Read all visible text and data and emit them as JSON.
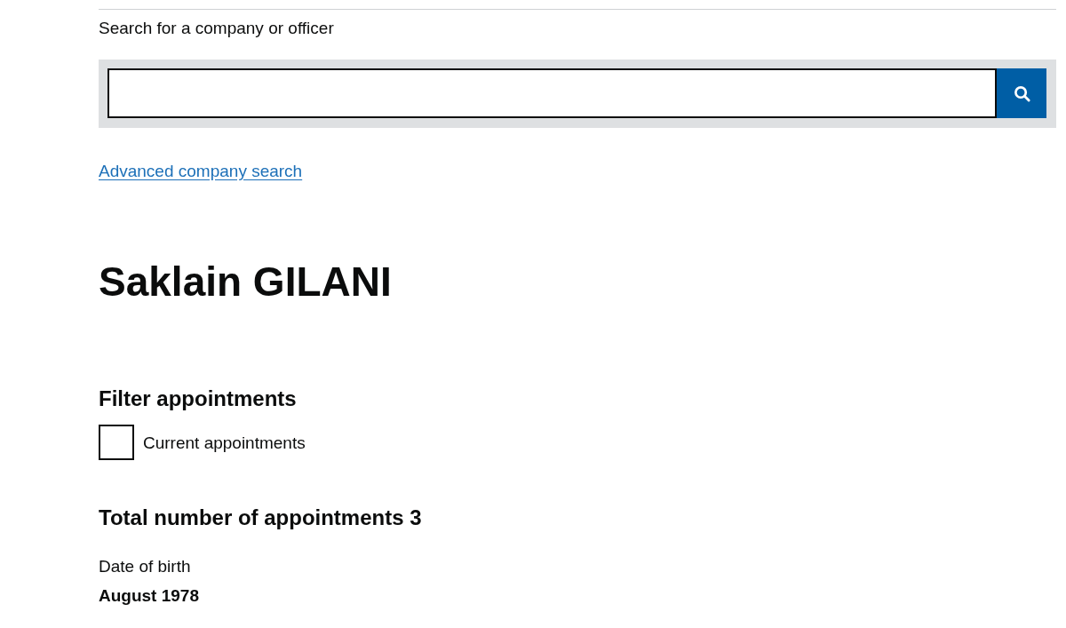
{
  "search": {
    "label": "Search for a company or officer"
  },
  "advanced_search_link": "Advanced company search",
  "officer_name": "Saklain GILANI",
  "filter": {
    "heading": "Filter appointments",
    "options": [
      {
        "label": "Current appointments",
        "checked": false
      }
    ]
  },
  "appointments_total": "Total number of appointments 3",
  "date_of_birth": {
    "label": "Date of birth",
    "value": "August 1978"
  }
}
